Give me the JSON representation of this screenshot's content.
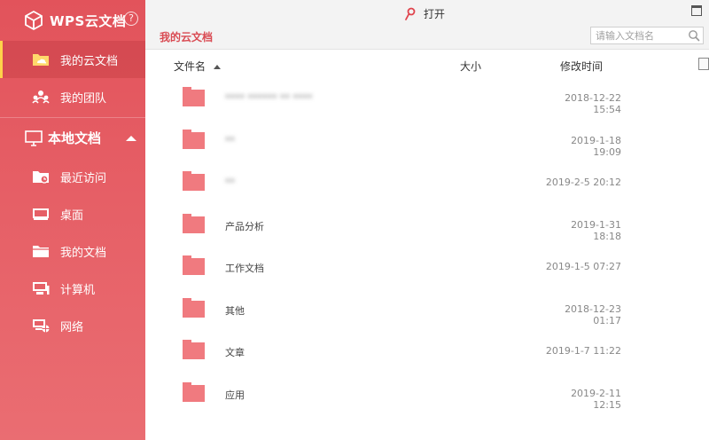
{
  "app": {
    "title": "WPS云文档",
    "help_glyph": "?"
  },
  "sidebar": {
    "cloud_items": [
      {
        "label": "我的云文档",
        "icon": "cloud-folder-icon",
        "active": true
      },
      {
        "label": "我的团队",
        "icon": "team-icon",
        "active": false
      }
    ],
    "local_group": {
      "label": "本地文档",
      "icon": "monitor-icon",
      "expanded": true
    },
    "local_items": [
      {
        "label": "最近访问",
        "icon": "recent-folder-icon"
      },
      {
        "label": "桌面",
        "icon": "desktop-icon"
      },
      {
        "label": "我的文档",
        "icon": "documents-folder-icon"
      },
      {
        "label": "计算机",
        "icon": "computer-icon"
      },
      {
        "label": "网络",
        "icon": "network-icon"
      }
    ]
  },
  "toolbar": {
    "open_label": "打开",
    "open_icon": "open-link-icon"
  },
  "main": {
    "title": "我的云文档",
    "search": {
      "placeholder": "请输入文档名",
      "value": ""
    },
    "columns": {
      "name": "文件名",
      "size": "大小",
      "modified": "修改时间"
    },
    "files": [
      {
        "name": "**** ****** ** ****",
        "size": "",
        "modified": "2018-12-22 15:54",
        "obscured": true
      },
      {
        "name": "**",
        "size": "",
        "modified": "2019-1-18 19:09",
        "obscured": true
      },
      {
        "name": "**",
        "size": "",
        "modified": "2019-2-5 20:12",
        "obscured": true
      },
      {
        "name": "产品分析",
        "size": "",
        "modified": "2019-1-31 18:18",
        "obscured": false
      },
      {
        "name": "工作文档",
        "size": "",
        "modified": "2019-1-5 07:27",
        "obscured": false
      },
      {
        "name": "其他",
        "size": "",
        "modified": "2018-12-23 01:17",
        "obscured": false
      },
      {
        "name": "文章",
        "size": "",
        "modified": "2019-1-7 11:22",
        "obscured": false
      },
      {
        "name": "应用",
        "size": "",
        "modified": "2019-2-11 12:15",
        "obscured": false
      }
    ]
  },
  "colors": {
    "sidebar": "#e2535b",
    "accent": "#d94a52",
    "folder": "#f07a7f",
    "active_marker": "#ffd24a"
  }
}
